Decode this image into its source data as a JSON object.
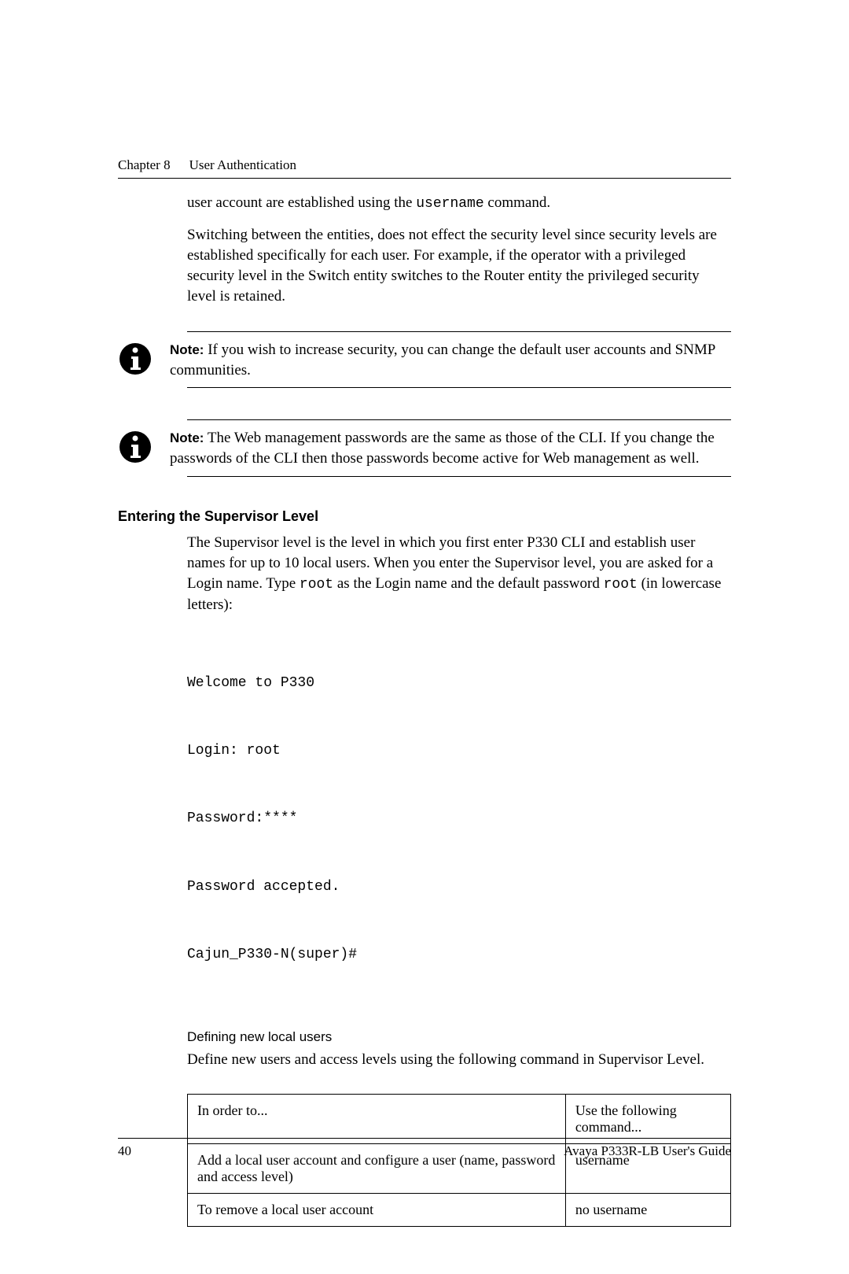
{
  "header": {
    "chapter": "Chapter 8",
    "title": "User Authentication"
  },
  "intro": {
    "line1_pre": "user account are established using the ",
    "line1_code": "username",
    "line1_post": " command.",
    "para2": "Switching between the entities, does not effect the security level since security levels are established specifically for each user. For example, if the operator with a privileged security level in the Switch entity switches to the Router entity the privileged security level is retained."
  },
  "note1": {
    "label": "Note:",
    "text": "  If you wish to increase security, you can change the default user accounts and SNMP communities."
  },
  "note2": {
    "label": "Note:",
    "text": "  The Web management passwords are the same as those of the CLI. If you change the passwords of the CLI then those passwords become active for Web management as well."
  },
  "section": {
    "heading": "Entering the Supervisor Level",
    "para1_pre": "The Supervisor level is the level in which you first enter P330 CLI and establish user names for up to 10 local users. When you enter the Supervisor level, you are asked for a Login name. Type  ",
    "para1_code1": "root",
    "para1_mid": "  as the Login name and the default password  ",
    "para1_code2": "root",
    "para1_post": "  (in lowercase letters):",
    "code_lines": [
      "Welcome to P330",
      "Login: root",
      "Password:****",
      "Password accepted.",
      "Cajun_P330-N(super)#"
    ],
    "subheading": "Defining new local users",
    "para2": "Define new users and access levels using the following command in Supervisor Level."
  },
  "table": {
    "col1_header": "In order to...",
    "col2_header": "Use the following command...",
    "rows": [
      {
        "c1": "Add a local user account and configure a user (name, password and access level)",
        "c2": "username"
      },
      {
        "c1": "To remove a local user account",
        "c2": "no username"
      }
    ]
  },
  "footer": {
    "page_number": "40",
    "guide_title": "Avaya P333R-LB User's Guide"
  }
}
